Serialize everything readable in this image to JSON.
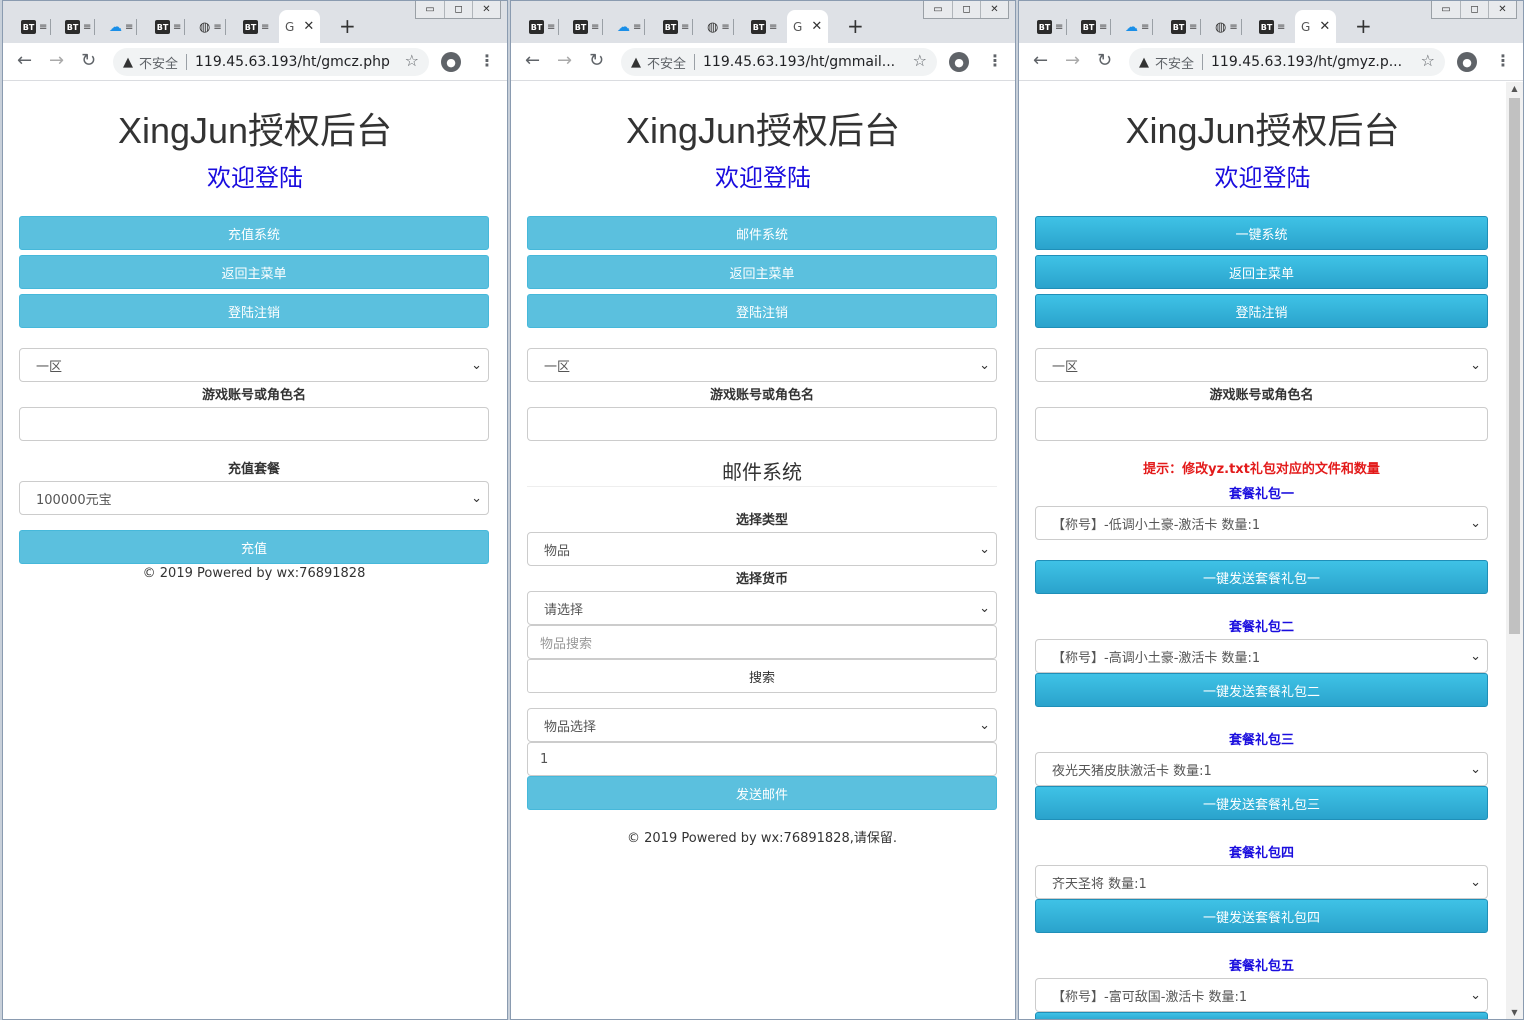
{
  "tabs": {
    "bt": "BT",
    "new_tab": "+",
    "close": "✕",
    "g": "G"
  },
  "browser": {
    "insecure": "不安全",
    "url1": "119.45.63.193/ht/gmcz.php",
    "url2": "119.45.63.193/ht/gmmail...",
    "url3": "119.45.63.193/ht/gmyz.p..."
  },
  "common": {
    "title": "XingJun授权后台",
    "welcome": "欢迎登陆",
    "back_menu": "返回主菜单",
    "logout": "登陆注销",
    "server": "一区",
    "account_label": "游戏账号或角色名"
  },
  "w1": {
    "system_btn": "充值系统",
    "package_label": "充值套餐",
    "package_value": "100000元宝",
    "submit": "充值",
    "footer": "© 2019 Powered by wx:76891828"
  },
  "w2": {
    "system_btn": "邮件系统",
    "section_title": "邮件系统",
    "type_label": "选择类型",
    "type_value": "物品",
    "currency_label": "选择货币",
    "currency_value": "请选择",
    "search_placeholder": "物品搜索",
    "search_btn": "搜索",
    "item_select": "物品选择",
    "qty": "1",
    "send": "发送邮件",
    "footer": "© 2019 Powered by wx:76891828,请保留."
  },
  "w3": {
    "system_btn": "一键系统",
    "hint": "提示：修改yz.txt礼包对应的文件和数量",
    "packs": [
      {
        "label": "套餐礼包一",
        "value": "【称号】-低调小土豪-激活卡 数量:1",
        "btn": "一键发送套餐礼包一"
      },
      {
        "label": "套餐礼包二",
        "value": "【称号】-高调小土豪-激活卡 数量:1",
        "btn": "一键发送套餐礼包二"
      },
      {
        "label": "套餐礼包三",
        "value": "夜光天猪皮肤激活卡 数量:1",
        "btn": "一键发送套餐礼包三"
      },
      {
        "label": "套餐礼包四",
        "value": "齐天圣将 数量:1",
        "btn": "一键发送套餐礼包四"
      },
      {
        "label": "套餐礼包五",
        "value": "【称号】-富可敌国-激活卡 数量:1",
        "btn": ""
      }
    ]
  }
}
